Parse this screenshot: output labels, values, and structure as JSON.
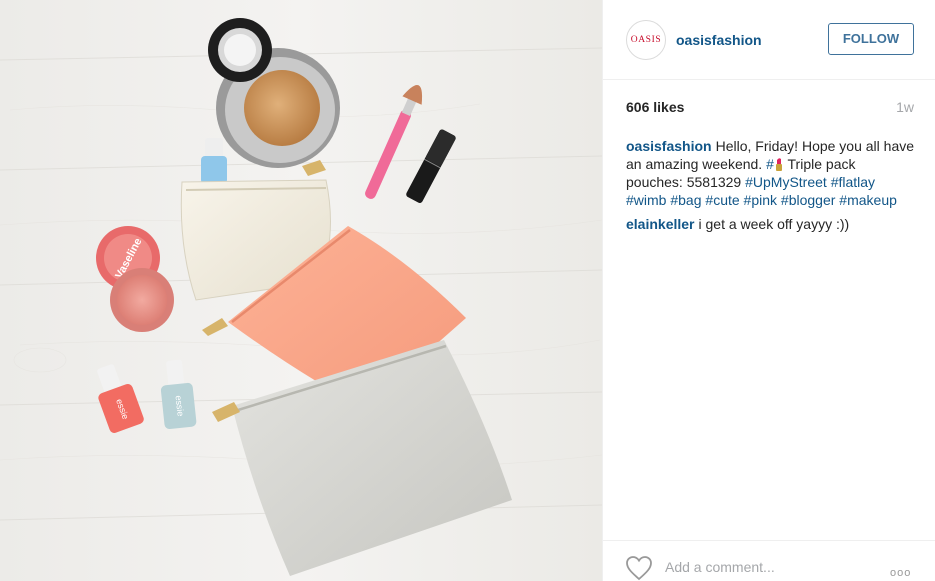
{
  "post": {
    "username": "oasisfashion",
    "avatar_text": "OASIS",
    "follow_label": "FOLLOW",
    "likes": "606 likes",
    "timestamp": "1w",
    "caption": {
      "user": "oasisfashion",
      "text_1": "Hello, Friday! Hope you all have an amazing weekend. ",
      "hash_1": "#",
      "text_2": " Triple pack pouches: 5581329 ",
      "tags": [
        "#UpMyStreet",
        "#flatlay",
        "#wimb",
        "#bag",
        "#cute",
        "#pink",
        "#blogger",
        "#makeup"
      ]
    },
    "comment": {
      "user": "elainkeller",
      "text": "i get a week off yayyy :))"
    },
    "add_comment_placeholder": "Add a comment...",
    "more_label": "ooo"
  },
  "photo": {
    "product_labels": {
      "vaseline": "Vaseline",
      "essie_1": "essie",
      "essie_2": "essie"
    }
  },
  "colors": {
    "link": "#125688",
    "follow": "#3f729b",
    "muted": "#a5a7aa"
  },
  "icons": {
    "heart": "heart-outline-icon",
    "more": "more-options-icon",
    "lipstick": "lipstick-emoji-icon"
  }
}
